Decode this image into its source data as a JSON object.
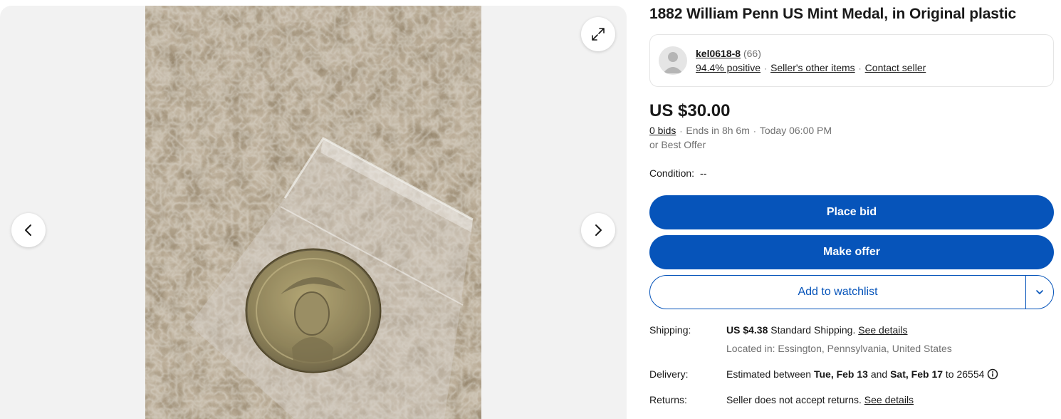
{
  "gallery": {
    "image_subject": "coin-in-plastic-bag-photo"
  },
  "title": "1882 William Penn US Mint Medal, in Original plastic",
  "seller": {
    "name": "kel0618-8",
    "feedback_count": "(66)",
    "positive": "94.4% positive",
    "other_items": "Seller's other items",
    "contact": "Contact seller"
  },
  "price": "US $30.00",
  "bids": {
    "count": "0 bids",
    "ends": "Ends in 8h 6m",
    "end_time": "Today 06:00 PM",
    "best_offer": "or Best Offer"
  },
  "condition": {
    "label": "Condition:",
    "value": "--"
  },
  "buttons": {
    "place_bid": "Place bid",
    "make_offer": "Make offer",
    "watchlist": "Add to watchlist"
  },
  "shipping": {
    "label": "Shipping:",
    "price": "US $4.38",
    "method": "Standard Shipping.",
    "details": "See details",
    "location": "Located in: Essington, Pennsylvania, United States"
  },
  "delivery": {
    "label": "Delivery:",
    "prefix": "Estimated between",
    "start": "Tue, Feb 13",
    "and": "and",
    "end": "Sat, Feb 17",
    "to": "to 26554"
  },
  "returns": {
    "label": "Returns:",
    "text": "Seller does not accept returns.",
    "details": "See details"
  },
  "colors": {
    "primary": "#0654ba",
    "text": "#191919",
    "muted": "#707070",
    "gallery_bg": "#f2f2f2"
  }
}
